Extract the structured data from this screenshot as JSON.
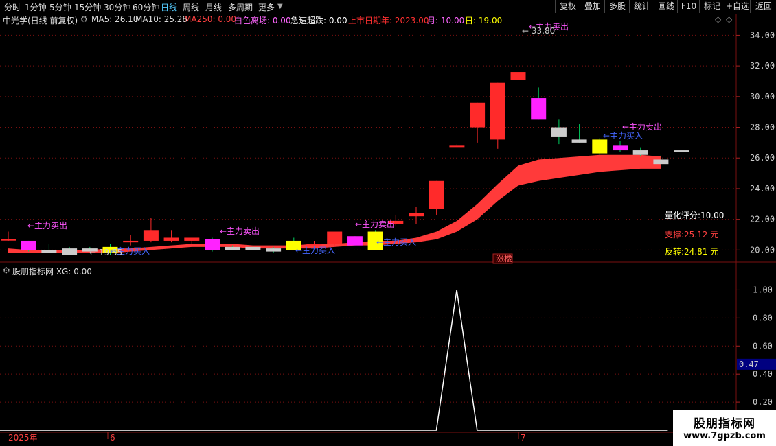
{
  "toolbar": {
    "periods": [
      "分时",
      "1分钟",
      "5分钟",
      "15分钟",
      "30分钟",
      "60分钟",
      "日线",
      "周线",
      "月线",
      "多周期",
      "更多"
    ],
    "active_period": "日线",
    "buttons": [
      "复权",
      "叠加",
      "多股",
      "统计",
      "画线",
      "F10",
      "标记",
      "+自选",
      "返回"
    ]
  },
  "info": {
    "title": "中光学(日线 前复权)",
    "ma5": "MA5: 26.10",
    "ma10": "MA10: 25.28",
    "ma250": "MA250: 0.00",
    "bai": "白色离场: 0.00",
    "jisu": "急速超跌: 0.00",
    "listing": "上市日期年: 2023.00",
    "month": "月: 10.00",
    "day": "日: 19.00"
  },
  "indicator": {
    "title": "股朋指标网 XG: 0.00",
    "current_value": "0.47"
  },
  "side": {
    "score": "量化评分:10.00",
    "support": "支撑:25.12 元",
    "reversal": "反转:24.81 元"
  },
  "labels": {
    "sell": "←主力卖出",
    "buy": "←主力买入",
    "high": "33.80",
    "low": "19.55",
    "zhangting": "涨楼"
  },
  "xaxis": {
    "year": "2025年",
    "m6": "6",
    "m7": "7"
  },
  "logo": {
    "line1": "股朋指标网",
    "line2": "www.7gpzb.com"
  },
  "colors": {
    "up": "#ff3030",
    "down": "#00d0d0",
    "band": "#ff3a3a",
    "grid": "#7a1010"
  },
  "chart_data": {
    "type": "candlestick",
    "ylim": [
      19.3,
      34.6
    ],
    "yticks": [
      20.0,
      22.0,
      24.0,
      26.0,
      28.0,
      30.0,
      32.0,
      34.0
    ],
    "candles": [
      {
        "o": 20.7,
        "h": 21.2,
        "l": 20.6,
        "c": 20.7,
        "color": "red"
      },
      {
        "o": 20.0,
        "h": 20.6,
        "l": 19.9,
        "c": 20.6,
        "color": "magenta"
      },
      {
        "o": 20.0,
        "h": 20.4,
        "l": 19.8,
        "c": 19.8,
        "color": "white"
      },
      {
        "o": 20.1,
        "h": 20.2,
        "l": 19.7,
        "c": 19.7,
        "color": "white"
      },
      {
        "o": 20.1,
        "h": 20.2,
        "l": 19.9,
        "c": 19.9,
        "color": "white"
      },
      {
        "o": 20.2,
        "h": 20.4,
        "l": 19.7,
        "c": 19.8,
        "color": "yellow"
      },
      {
        "o": 20.6,
        "h": 21.0,
        "l": 20.3,
        "c": 20.5,
        "color": "red"
      },
      {
        "o": 20.6,
        "h": 22.1,
        "l": 20.5,
        "c": 21.3,
        "color": "red"
      },
      {
        "o": 20.8,
        "h": 21.3,
        "l": 20.5,
        "c": 20.6,
        "color": "red"
      },
      {
        "o": 20.6,
        "h": 20.8,
        "l": 20.4,
        "c": 20.8,
        "color": "red"
      },
      {
        "o": 20.0,
        "h": 20.8,
        "l": 19.9,
        "c": 20.7,
        "color": "magenta"
      },
      {
        "o": 20.2,
        "h": 20.3,
        "l": 20.0,
        "c": 20.0,
        "color": "white"
      },
      {
        "o": 20.2,
        "h": 20.3,
        "l": 20.0,
        "c": 20.0,
        "color": "white"
      },
      {
        "o": 20.1,
        "h": 20.2,
        "l": 19.8,
        "c": 19.9,
        "color": "white"
      },
      {
        "o": 20.0,
        "h": 20.8,
        "l": 20.0,
        "c": 20.6,
        "color": "yellow"
      },
      {
        "o": 20.4,
        "h": 20.6,
        "l": 20.3,
        "c": 20.4,
        "color": "red"
      },
      {
        "o": 20.4,
        "h": 21.1,
        "l": 20.3,
        "c": 21.2,
        "color": "red"
      },
      {
        "o": 20.3,
        "h": 20.9,
        "l": 20.3,
        "c": 20.9,
        "color": "magenta"
      },
      {
        "o": 20.0,
        "h": 21.3,
        "l": 20.0,
        "c": 21.2,
        "color": "yellow"
      },
      {
        "o": 21.7,
        "h": 22.3,
        "l": 21.6,
        "c": 21.9,
        "color": "red"
      },
      {
        "o": 22.2,
        "h": 22.8,
        "l": 21.7,
        "c": 22.4,
        "color": "red"
      },
      {
        "o": 22.7,
        "h": 24.5,
        "l": 22.3,
        "c": 24.5,
        "color": "red"
      },
      {
        "o": 26.8,
        "h": 26.9,
        "l": 26.8,
        "c": 26.8,
        "color": "red"
      },
      {
        "o": 28.0,
        "h": 29.6,
        "l": 27.0,
        "c": 29.6,
        "color": "red"
      },
      {
        "o": 27.2,
        "h": 30.9,
        "l": 26.6,
        "c": 30.9,
        "color": "red"
      },
      {
        "o": 31.1,
        "h": 33.8,
        "l": 30.0,
        "c": 31.6,
        "color": "red"
      },
      {
        "o": 28.5,
        "h": 30.6,
        "l": 28.5,
        "c": 29.9,
        "color": "magenta"
      },
      {
        "o": 27.4,
        "h": 28.5,
        "l": 26.9,
        "c": 28.0,
        "color": "white"
      },
      {
        "o": 27.0,
        "h": 28.2,
        "l": 27.0,
        "c": 27.2,
        "color": "white"
      },
      {
        "o": 26.3,
        "h": 27.3,
        "l": 26.2,
        "c": 27.2,
        "color": "yellow"
      },
      {
        "o": 26.5,
        "h": 27.1,
        "l": 26.4,
        "c": 26.8,
        "color": "magenta"
      },
      {
        "o": 26.2,
        "h": 26.7,
        "l": 26.1,
        "c": 26.5,
        "color": "white"
      },
      {
        "o": 25.6,
        "h": 26.2,
        "l": 25.5,
        "c": 25.9,
        "color": "white"
      },
      {
        "o": 26.5,
        "h": 26.5,
        "l": 26.5,
        "c": 26.5,
        "color": "white"
      }
    ],
    "band_upper": [
      20.1,
      20.0,
      20.0,
      20.0,
      20.0,
      20.1,
      20.1,
      20.2,
      20.3,
      20.4,
      20.4,
      20.4,
      20.3,
      20.3,
      20.3,
      20.4,
      20.4,
      20.5,
      20.6,
      20.6,
      20.8,
      21.2,
      21.9,
      23.0,
      24.3,
      25.5,
      25.9,
      26.0,
      26.1,
      26.2,
      26.2,
      26.2,
      26.1
    ],
    "band_lower": [
      19.8,
      19.8,
      19.8,
      19.8,
      19.8,
      19.8,
      19.9,
      20.0,
      20.1,
      20.2,
      20.2,
      20.2,
      20.1,
      20.1,
      20.1,
      20.1,
      20.2,
      20.3,
      20.3,
      20.4,
      20.5,
      20.7,
      21.2,
      22.0,
      23.2,
      24.2,
      24.5,
      24.7,
      24.9,
      25.1,
      25.2,
      25.3,
      25.3
    ],
    "indicator_ylim": [
      0.0,
      1.1
    ],
    "indicator_yticks": [
      0.2,
      0.4,
      0.6,
      0.8,
      1.0
    ],
    "indicator_values": [
      0,
      0,
      0,
      0,
      0,
      0,
      0,
      0,
      0,
      0,
      0,
      0,
      0,
      0,
      0,
      0,
      0,
      0,
      0,
      0,
      0,
      0,
      0,
      1,
      0,
      0,
      0,
      0,
      0,
      0,
      0,
      0,
      0
    ]
  }
}
